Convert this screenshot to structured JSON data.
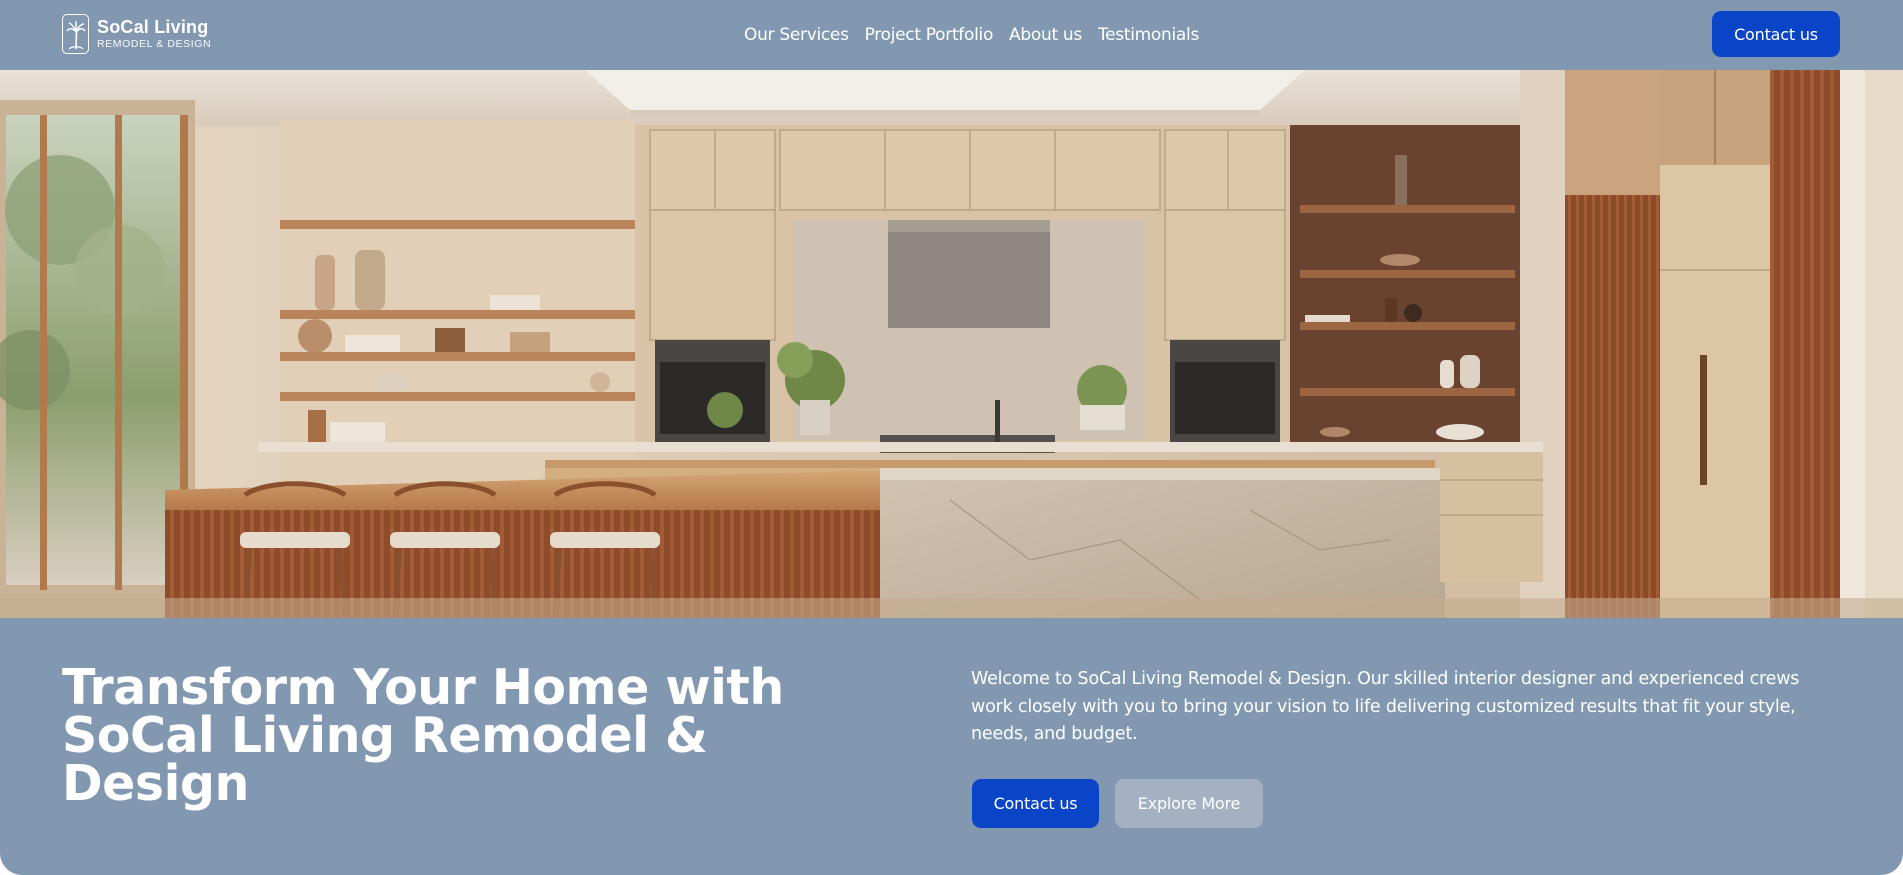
{
  "brand": {
    "name": "SoCal Living",
    "tagline": "REMODEL & DESIGN"
  },
  "nav": {
    "items": [
      {
        "label": "Our Services"
      },
      {
        "label": "Project Portfolio"
      },
      {
        "label": "About us"
      },
      {
        "label": "Testimonials"
      }
    ],
    "cta_label": "Contact us"
  },
  "hero": {
    "image": "modern-kitchen-photo"
  },
  "main": {
    "headline": "Transform Your Home with SoCal Living Remodel & Design",
    "intro": "Welcome to SoCal Living Remodel & Design. Our skilled interior designer and experienced crews work closely with you to bring your vision to life delivering customized results that fit your style, needs, and budget.",
    "primary_button": "Contact us",
    "secondary_button": "Explore More"
  },
  "colors": {
    "background": "#8198b0",
    "primary": "#0a45c8",
    "secondary": "#a3b1c3",
    "text": "#ffffff"
  }
}
